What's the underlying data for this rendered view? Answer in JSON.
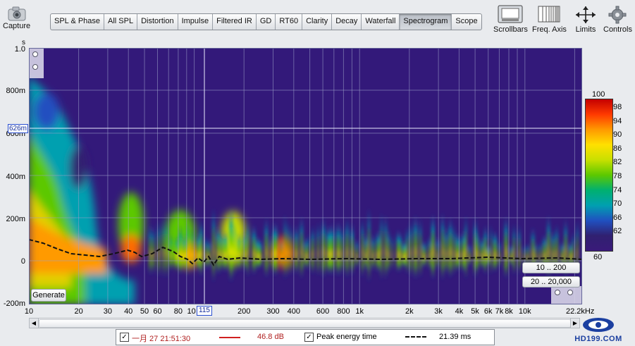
{
  "toolbar": {
    "capture_label": "Capture",
    "tabs": [
      "SPL & Phase",
      "All SPL",
      "Distortion",
      "Impulse",
      "Filtered IR",
      "GD",
      "RT60",
      "Clarity",
      "Decay",
      "Waterfall",
      "Spectrogram",
      "Scope"
    ],
    "active_tab": "Spectrogram",
    "right_buttons": [
      "Scrollbars",
      "Freq. Axis",
      "Limits",
      "Controls"
    ]
  },
  "plot": {
    "y_unit": "s",
    "y_ticks": [
      "1.0",
      "800m",
      "600m",
      "400m",
      "200m",
      "0",
      "-200m"
    ],
    "y_cursor_label": "626m",
    "x_ticks": [
      "10",
      "20",
      "30",
      "40",
      "50",
      "60",
      "80",
      "100",
      "200",
      "300",
      "400",
      "600",
      "800",
      "1k",
      "2k",
      "3k",
      "4k",
      "5k",
      "6k",
      "7k",
      "8k",
      "10k"
    ],
    "x_unit_label": "22.2kHz",
    "x_cursor_label": "115",
    "generate_label": "Generate",
    "range_buttons": [
      "10 .. 200",
      "20 .. 20,000"
    ]
  },
  "colorbar": {
    "top_label": "100",
    "bottom_label": "60",
    "ticks": [
      "98",
      "94",
      "90",
      "86",
      "82",
      "78",
      "74",
      "70",
      "66",
      "62"
    ],
    "colors": [
      "#c40000",
      "#ff3a00",
      "#ff9a00",
      "#ffe000",
      "#c8e000",
      "#5cc800",
      "#00b070",
      "#00a0b0",
      "#2050c0",
      "#302070",
      "#3a1a7a"
    ]
  },
  "legend": {
    "series1_checked": true,
    "series1_name": "一月 27 21:51:30",
    "series1_value": "46.8 dB",
    "series1_color": "#d02020",
    "series2_checked": true,
    "series2_name": "Peak energy time",
    "series2_value": "21.39 ms"
  },
  "watermark": "HD199.COM"
}
